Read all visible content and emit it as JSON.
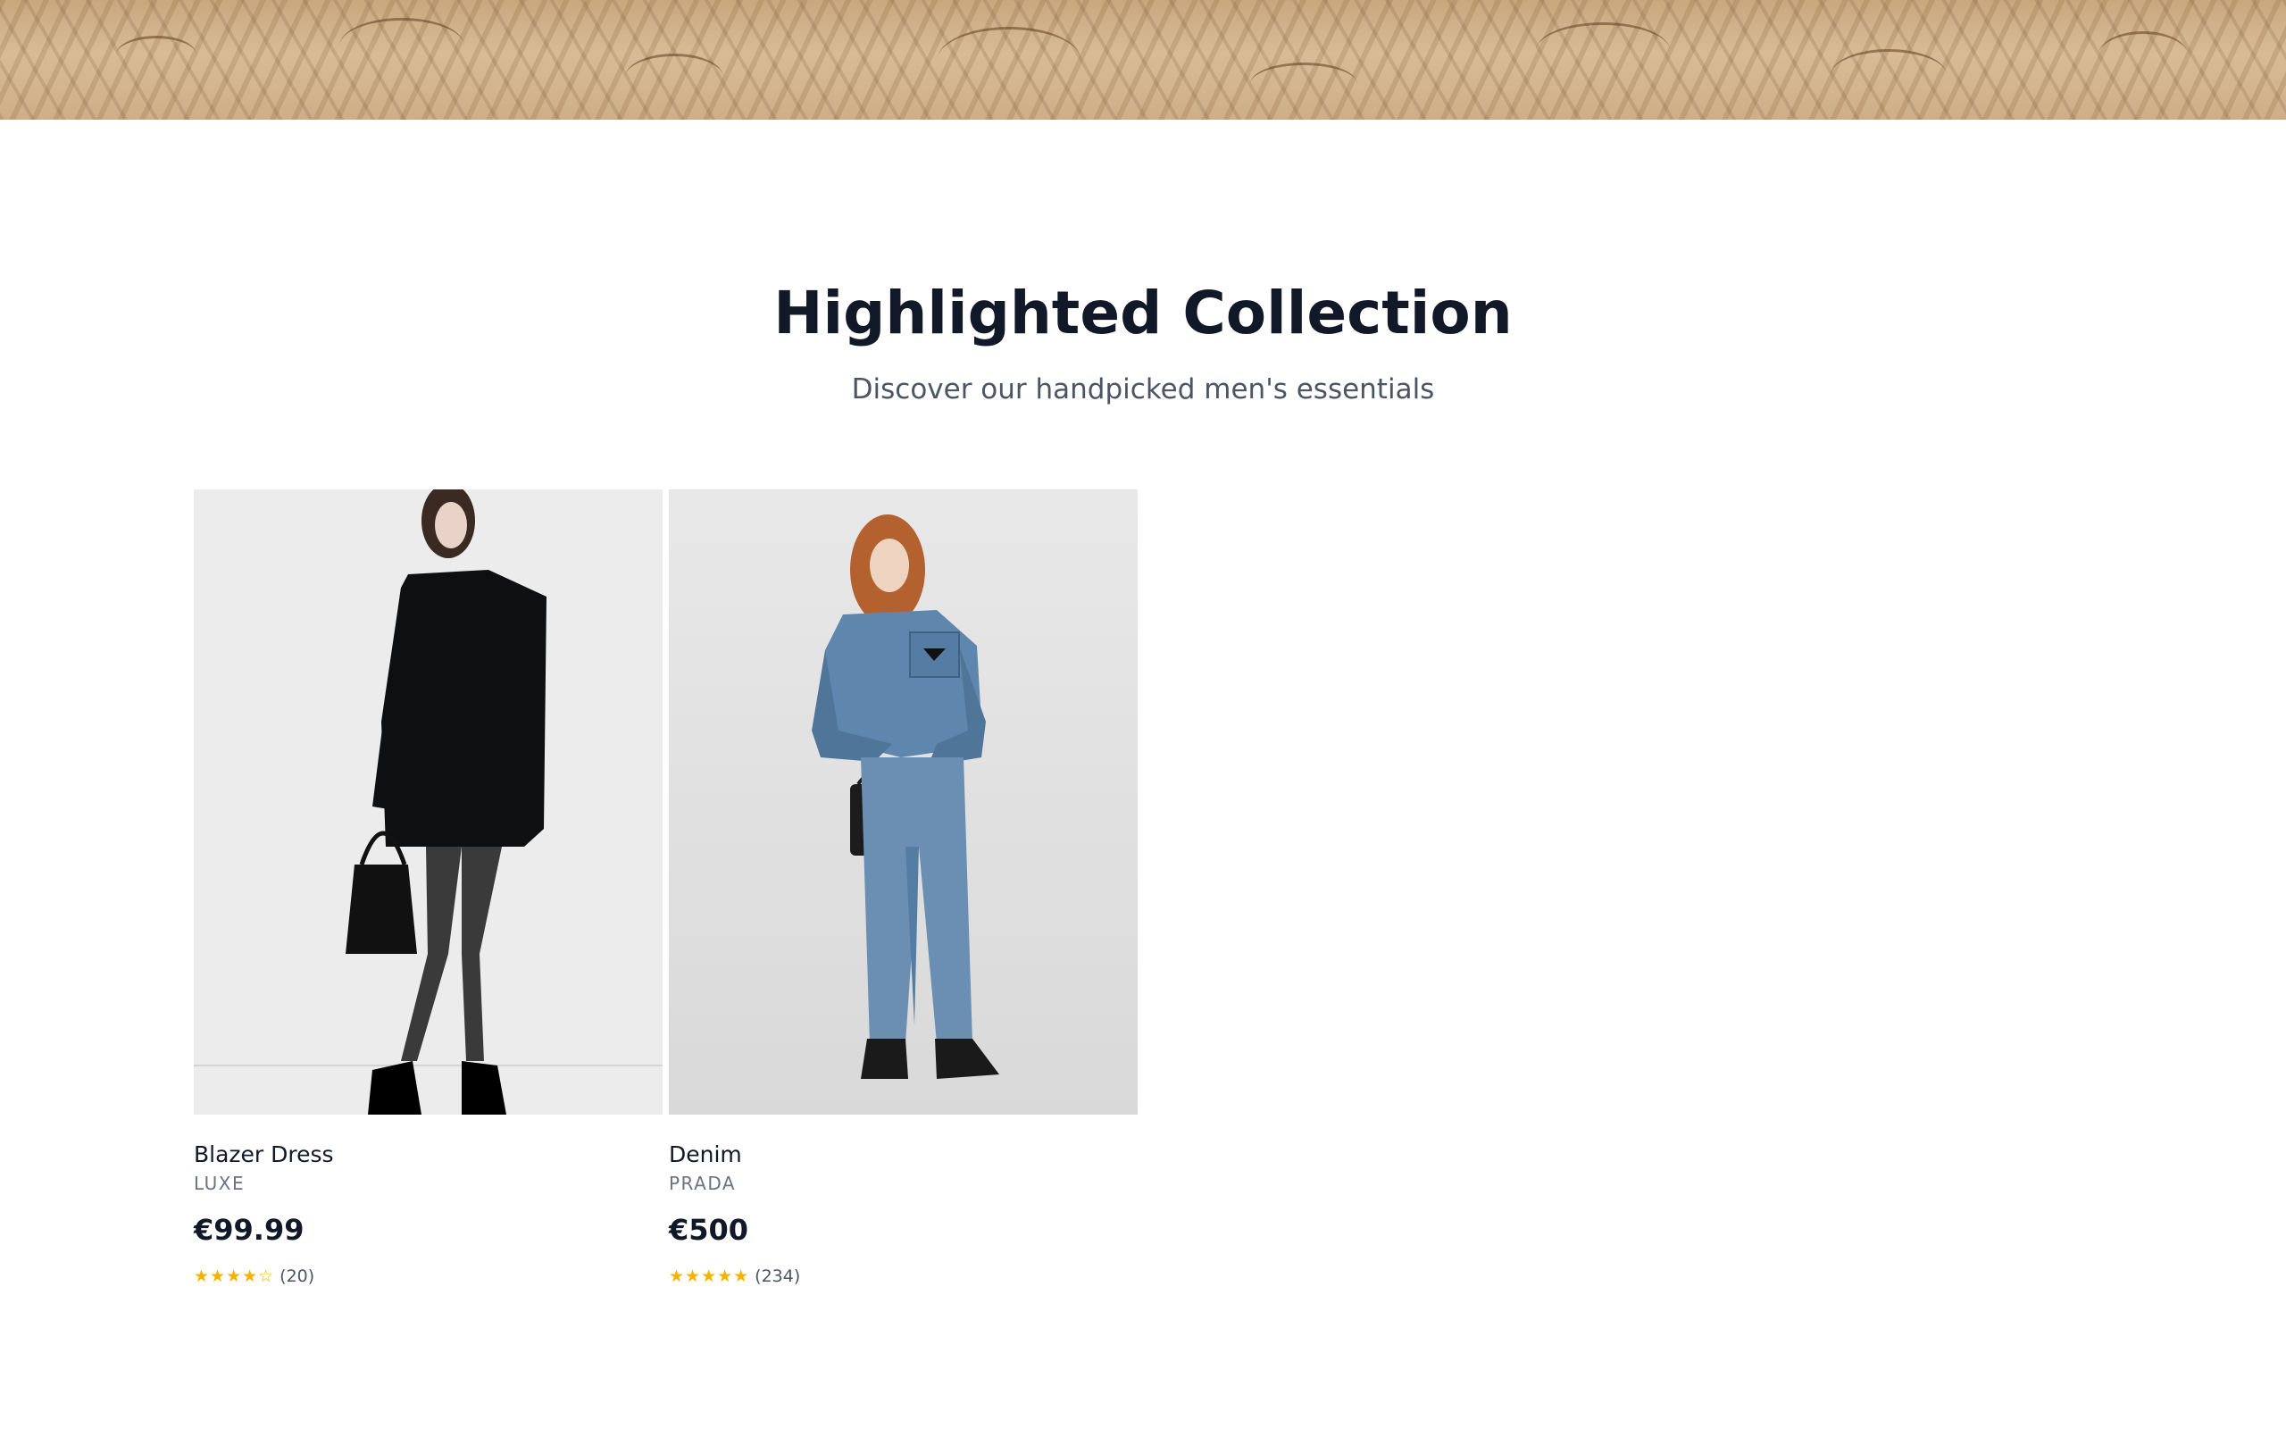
{
  "section": {
    "title": "Highlighted Collection",
    "subtitle": "Discover our handpicked men's essentials"
  },
  "products": [
    {
      "name": "Blazer Dress",
      "brand": "LUXE",
      "price": "€99.99",
      "stars": "★★★★☆",
      "rating": 4,
      "review_count": "(20)",
      "image_icon": "model-black-blazer-dress-photo"
    },
    {
      "name": "Denim",
      "brand": "PRADA",
      "price": "€500",
      "stars": "★★★★★",
      "rating": 5,
      "review_count": "(234)",
      "image_icon": "model-denim-set-photo"
    }
  ],
  "colors": {
    "title": "#111827",
    "subtitle": "#4b5563",
    "brand": "#6b7280",
    "star": "#f5b301",
    "image_bg": "#ececec"
  }
}
